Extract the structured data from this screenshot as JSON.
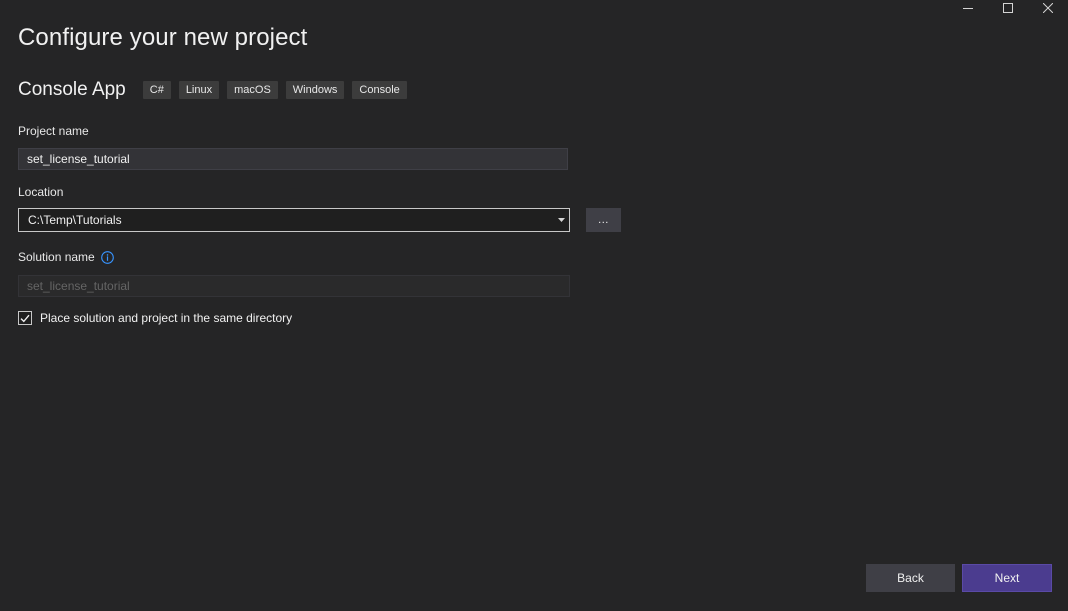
{
  "window": {
    "controls": [
      "minimize-icon",
      "maximize-icon",
      "close-icon"
    ]
  },
  "page": {
    "title": "Configure your new project"
  },
  "template": {
    "name": "Console App",
    "tags": [
      "C#",
      "Linux",
      "macOS",
      "Windows",
      "Console"
    ]
  },
  "project_name": {
    "label": "Project name",
    "value": "set_license_tutorial"
  },
  "location": {
    "label": "Location",
    "value": "C:\\Temp\\Tutorials",
    "browse_label": "..."
  },
  "solution_name": {
    "label": "Solution name",
    "placeholder": "set_license_tutorial",
    "info_icon": "info-icon"
  },
  "same_directory": {
    "label": "Place solution and project in the same directory",
    "checked": true
  },
  "footer": {
    "back_label": "Back",
    "next_label": "Next"
  },
  "colors": {
    "background": "#252526",
    "accent": "#4b3c8f",
    "info": "#3794ff"
  }
}
